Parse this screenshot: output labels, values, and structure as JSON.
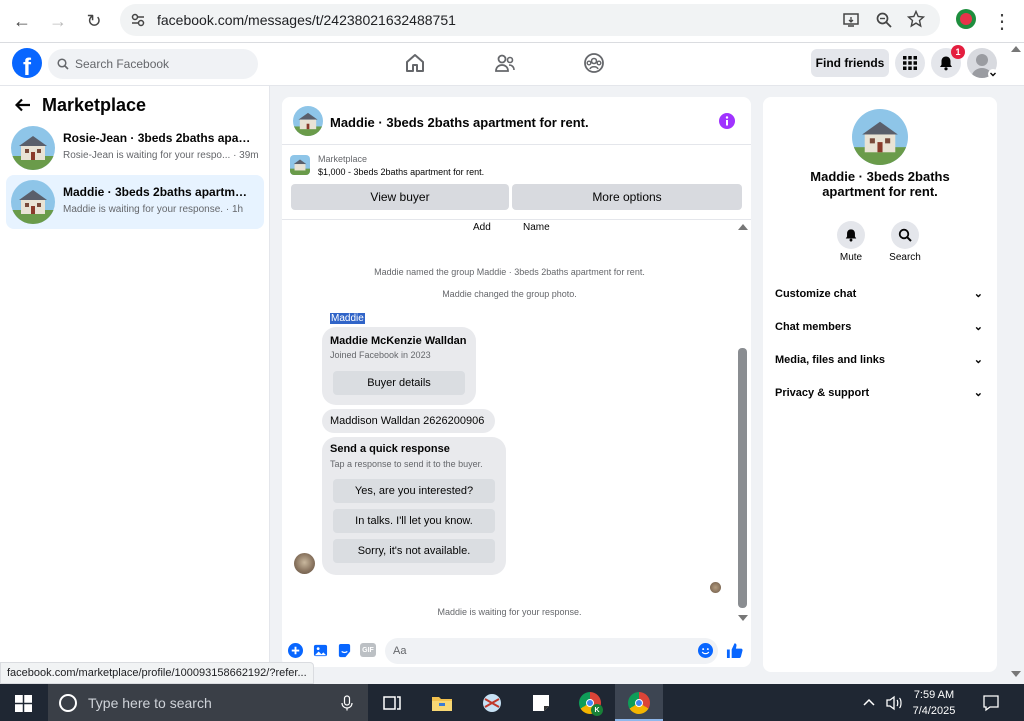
{
  "browser": {
    "url": "facebook.com/messages/t/24238021632488751",
    "status_url": "facebook.com/marketplace/profile/100093158662192/?refer..."
  },
  "header": {
    "search_placeholder": "Search Facebook",
    "find_friends": "Find friends",
    "notif_count": "1"
  },
  "sidebar": {
    "title": "Marketplace",
    "threads": [
      {
        "title": "Rosie-Jean · 3beds 2baths apartm...",
        "preview": "Rosie-Jean is waiting for your respo... · 39m"
      },
      {
        "title": "Maddie · 3beds 2baths apartment ...",
        "preview": "Maddie is waiting for your response. · 1h"
      }
    ]
  },
  "chat": {
    "title": "Maddie · 3beds 2baths apartment for rent.",
    "listing_label": "Marketplace",
    "listing_price": "$1,000 - 3beds 2baths apartment for rent.",
    "view_buyer": "View buyer",
    "more_options": "More options",
    "add_label": "Add",
    "name_label": "Name",
    "system_1": "Maddie named the group Maddie · 3beds 2baths apartment for rent.",
    "system_2": "Maddie changed the group photo.",
    "sender_tag": "Maddie",
    "profile_name": "Maddie McKenzie Walldan",
    "profile_joined": "Joined Facebook in 2023",
    "buyer_details": "Buyer details",
    "message_1": "Maddison Walldan 2626200906",
    "quick_title": "Send a quick response",
    "quick_sub": "Tap a response to send it to the buyer.",
    "quick_replies": [
      "Yes, are you interested?",
      "In talks. I'll let you know.",
      "Sorry, it's not available."
    ],
    "waiting": "Maddie is waiting for your response.",
    "composer_placeholder": "Aa"
  },
  "right_panel": {
    "title": "Maddie · 3beds 2baths apartment for rent.",
    "mute": "Mute",
    "search": "Search",
    "sections": [
      "Customize chat",
      "Chat members",
      "Media, files and links",
      "Privacy & support"
    ]
  },
  "taskbar": {
    "search_placeholder": "Type here to search",
    "time": "7:59 AM",
    "date": "7/4/2025"
  },
  "colors": {
    "fb_blue": "#0866ff",
    "messenger_purple": "#a033ff",
    "selected_thread": "#e7f3ff"
  }
}
